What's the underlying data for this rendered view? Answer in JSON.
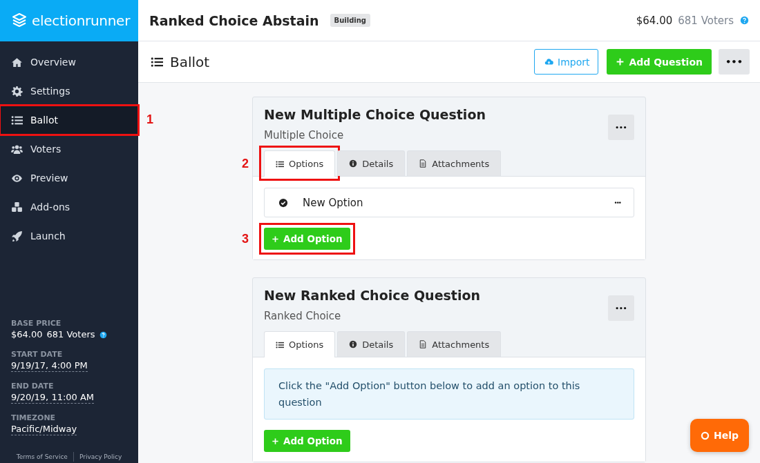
{
  "logo": {
    "text": "electionrunner"
  },
  "sidebar": {
    "items": [
      {
        "label": "Overview",
        "kind": "home",
        "selected": false
      },
      {
        "label": "Settings",
        "kind": "gear",
        "selected": false
      },
      {
        "label": "Ballot",
        "kind": "list",
        "selected": true,
        "callout": "1"
      },
      {
        "label": "Voters",
        "kind": "users",
        "selected": false
      },
      {
        "label": "Preview",
        "kind": "eye",
        "selected": false
      },
      {
        "label": "Add-ons",
        "kind": "cubes",
        "selected": false
      },
      {
        "label": "Launch",
        "kind": "rocket",
        "selected": false
      }
    ],
    "info": [
      {
        "label": "BASE PRICE",
        "value": "$64.00",
        "extra": "681 Voters"
      },
      {
        "label": "START DATE",
        "value": "9/19/17, 4:00 PM"
      },
      {
        "label": "END DATE",
        "value": "9/20/19, 11:00 AM"
      },
      {
        "label": "TIMEZONE",
        "value": "Pacific/Midway"
      }
    ],
    "footer_links": [
      "Terms of Service",
      "Privacy Policy"
    ]
  },
  "header": {
    "title": "Ranked Choice Abstain",
    "badge": "Building",
    "price": "$64.00",
    "voters": "681 Voters"
  },
  "toolbar": {
    "title": "Ballot",
    "import": "Import",
    "add_question": "Add Question",
    "more": "•••"
  },
  "questions": [
    {
      "title": "New Multiple Choice Question",
      "type": "Multiple Choice",
      "more": "•••",
      "tabs": [
        {
          "label": "Options",
          "kind": "list",
          "selected": true,
          "callout": "2"
        },
        {
          "label": "Details",
          "kind": "info",
          "selected": false
        },
        {
          "label": "Attachments",
          "kind": "file",
          "selected": false
        }
      ],
      "options": [
        {
          "label": "New Option",
          "more": "•••"
        }
      ],
      "add_option": {
        "label": "Add Option",
        "callout": "3"
      }
    },
    {
      "title": "New Ranked Choice Question",
      "type": "Ranked Choice",
      "more": "•••",
      "tabs": [
        {
          "label": "Options",
          "kind": "list",
          "selected": true
        },
        {
          "label": "Details",
          "kind": "info",
          "selected": false
        },
        {
          "label": "Attachments",
          "kind": "file",
          "selected": false
        }
      ],
      "notice": "Click the \"Add Option\" button below to add an option to this question",
      "add_option": {
        "label": "Add Option"
      }
    }
  ],
  "help_button": "Help"
}
